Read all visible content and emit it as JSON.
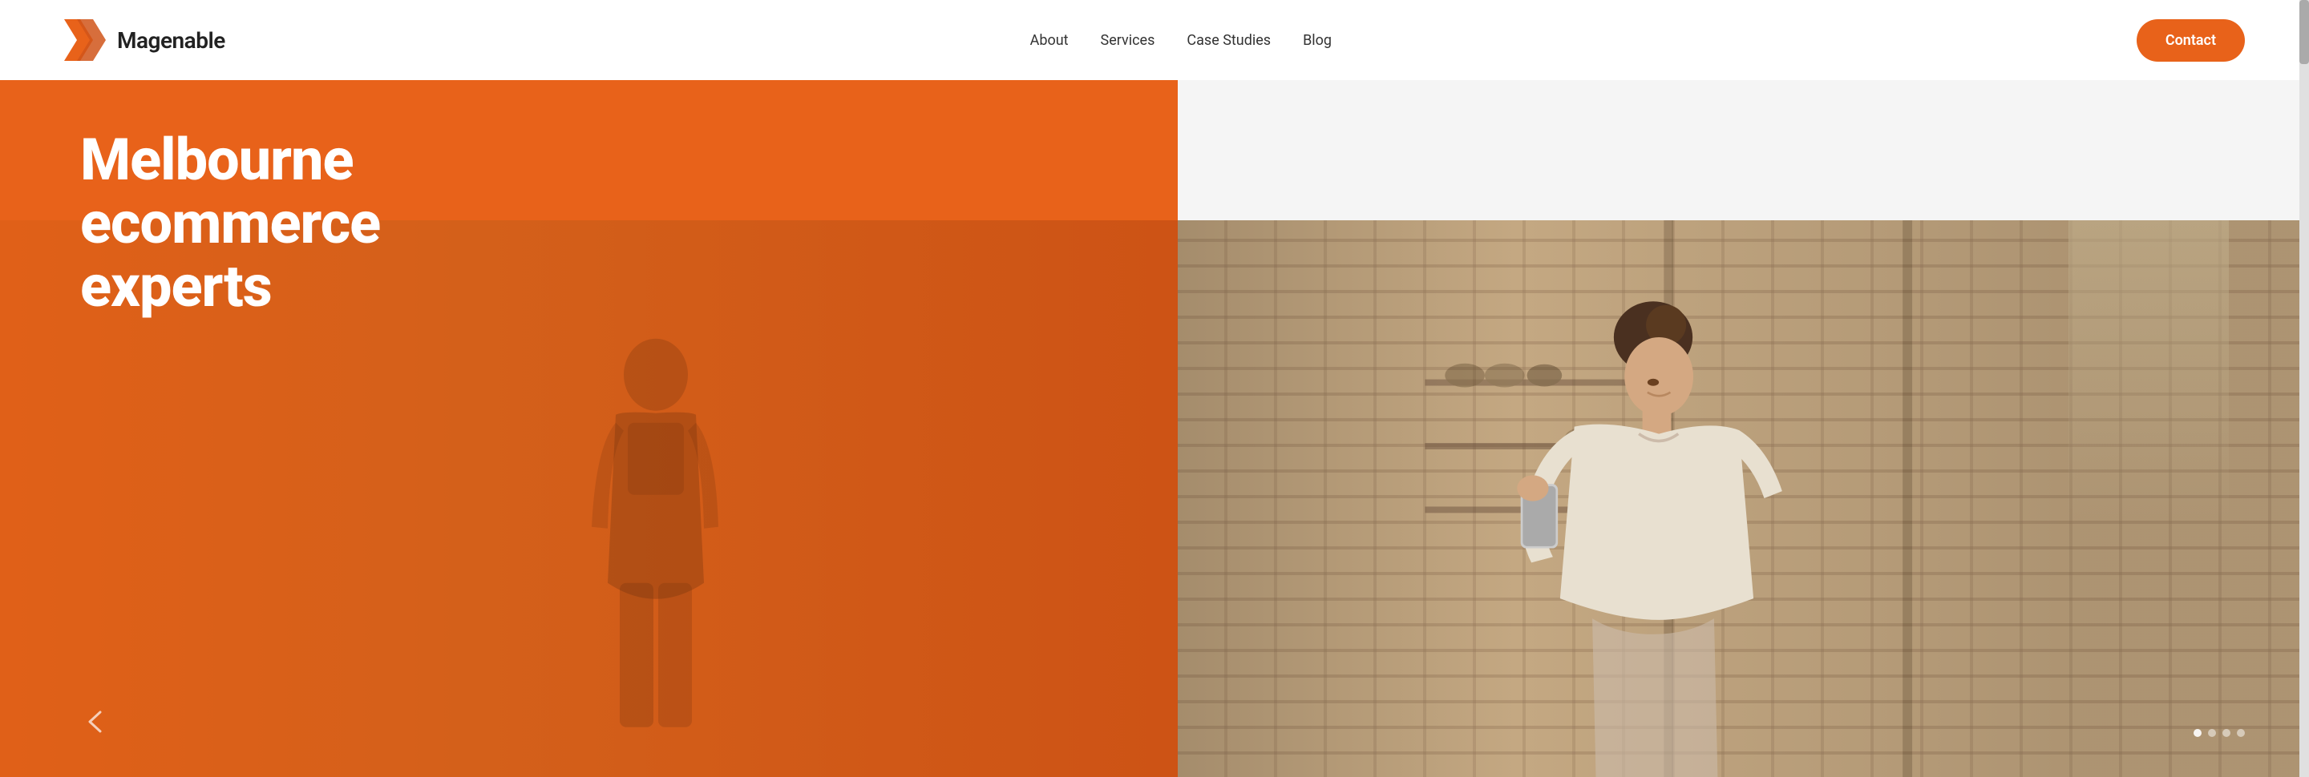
{
  "header": {
    "logo_text": "Magenable",
    "nav": {
      "items": [
        {
          "label": "About",
          "id": "about"
        },
        {
          "label": "Services",
          "id": "services"
        },
        {
          "label": "Case Studies",
          "id": "case-studies"
        },
        {
          "label": "Blog",
          "id": "blog"
        }
      ]
    },
    "contact_label": "Contact"
  },
  "hero": {
    "title_line1": "Melbourne",
    "title_line2": "ecommerce",
    "title_line3": "experts",
    "arrow_label": "‹",
    "dots": [
      true,
      false,
      false,
      false
    ],
    "accent_color": "#e8621a"
  }
}
